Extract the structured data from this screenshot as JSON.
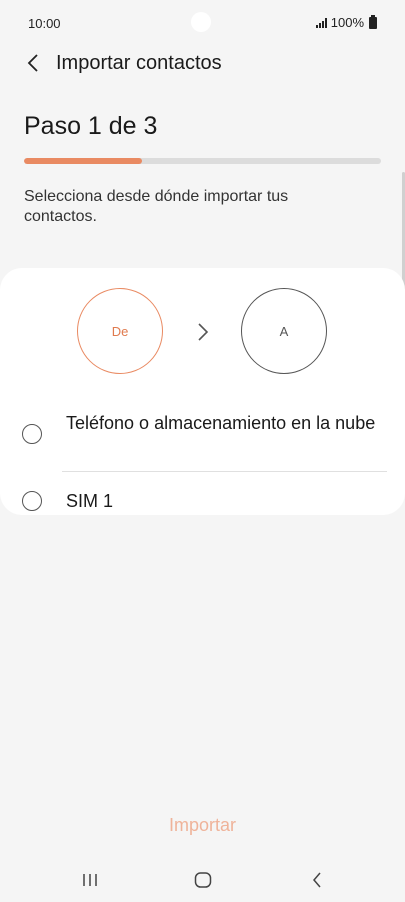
{
  "status_bar": {
    "time": "10:00",
    "battery": "100%"
  },
  "header": {
    "title": "Importar contactos"
  },
  "step": {
    "title": "Paso 1 de 3",
    "progress": 0.33
  },
  "instruction": "Selecciona desde dónde importar tus contactos.",
  "flow": {
    "from_label": "De",
    "to_label": "A"
  },
  "options": [
    {
      "label": "Teléfono o almacenamiento en la nube",
      "selected": false
    },
    {
      "label": "SIM 1",
      "selected": false
    }
  ],
  "actions": {
    "import_label": "Importar"
  },
  "colors": {
    "accent": "#e98a62",
    "accent_disabled": "#efb39a",
    "background": "#f5f5f5",
    "card": "#ffffff"
  }
}
